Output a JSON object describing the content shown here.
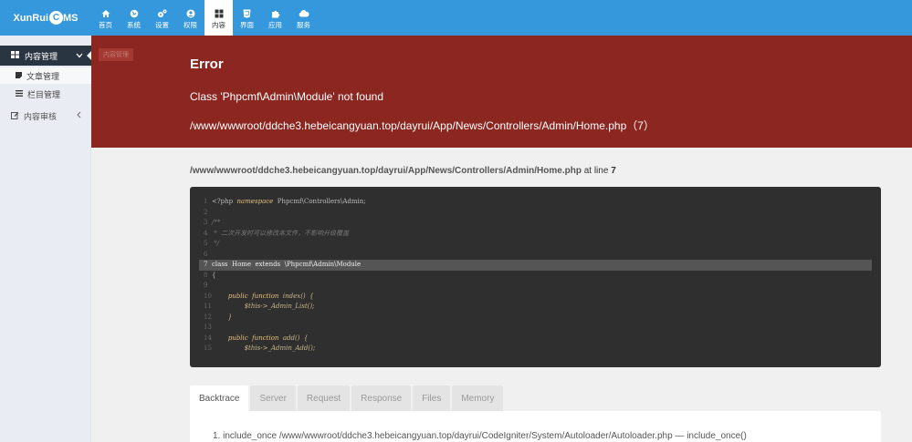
{
  "app": {
    "logo_left": "XunRui",
    "logo_c": "C",
    "logo_right": "MS"
  },
  "topnav": [
    {
      "label": "首页",
      "icon": "home-icon"
    },
    {
      "label": "系统",
      "icon": "globe-icon"
    },
    {
      "label": "设置",
      "icon": "gears-icon"
    },
    {
      "label": "权限",
      "icon": "user-icon"
    },
    {
      "label": "内容",
      "icon": "grid-icon",
      "active": true
    },
    {
      "label": "界面",
      "icon": "html5-icon"
    },
    {
      "label": "应用",
      "icon": "puzzle-icon"
    },
    {
      "label": "服务",
      "icon": "cloud-icon"
    }
  ],
  "sidebar": {
    "header": "内容管理",
    "items": [
      {
        "label": "文章管理",
        "icon": "square-icon"
      },
      {
        "label": "栏目管理",
        "icon": "list-icon"
      }
    ],
    "group": "内容审核"
  },
  "breadcrumb": "内容管理",
  "error": {
    "title": "Error",
    "message": "Class 'Phpcmf\\Admin\\Module' not found",
    "file": "/www/wwwroot/ddche3.hebeicangyuan.top/dayrui/App/News/Controllers/Admin/Home.php（7）"
  },
  "location": {
    "path": "/www/wwwroot/ddche3.hebeicangyuan.top/dayrui/App/News/Controllers/Admin/Home.php",
    "at_line": "at line",
    "line": "7"
  },
  "code_lines": [
    {
      "n": "1",
      "segs": [
        [
          "",
          "<?php  "
        ],
        [
          "kw",
          "namespace"
        ],
        [
          "",
          "  Phpcmf\\Controllers\\Admin;"
        ]
      ]
    },
    {
      "n": "2",
      "segs": []
    },
    {
      "n": "3",
      "segs": [
        [
          "cm",
          "/**"
        ]
      ]
    },
    {
      "n": "4",
      "segs": [
        [
          "cm",
          " *  二次开发时可以修改本文件，不影响升级覆盖"
        ]
      ]
    },
    {
      "n": "5",
      "segs": [
        [
          "cm",
          " */"
        ]
      ]
    },
    {
      "n": "6",
      "segs": []
    },
    {
      "n": "7",
      "hl": true,
      "segs": [
        [
          "",
          "class  Home  extends  \\Phpcmf\\Admin\\Module"
        ]
      ]
    },
    {
      "n": "8",
      "segs": [
        [
          "",
          "{"
        ]
      ]
    },
    {
      "n": "9",
      "segs": []
    },
    {
      "n": "10",
      "segs": [
        [
          "",
          "        "
        ],
        [
          "kw",
          "public  function"
        ],
        [
          "fn",
          "  index()  {"
        ]
      ]
    },
    {
      "n": "11",
      "segs": [
        [
          "fn",
          "                $this->_Admin_List();"
        ]
      ]
    },
    {
      "n": "12",
      "segs": [
        [
          "fn",
          "        }"
        ]
      ]
    },
    {
      "n": "13",
      "segs": []
    },
    {
      "n": "14",
      "segs": [
        [
          "",
          "        "
        ],
        [
          "kw",
          "public  function"
        ],
        [
          "fn",
          "  add()  {"
        ]
      ]
    },
    {
      "n": "15",
      "segs": [
        [
          "fn",
          "                $this->_Admin_Add();"
        ]
      ]
    }
  ],
  "tabs": [
    "Backtrace",
    "Server",
    "Request",
    "Response",
    "Files",
    "Memory"
  ],
  "backtrace": [
    "1. include_once /www/wwwroot/ddche3.hebeicangyuan.top/dayrui/CodeIgniter/System/Autoloader/Autoloader.php   —   include_once()"
  ],
  "colors": {
    "topbar": "#3598dc",
    "error_header": "#8b2620",
    "sidebar_header": "#2a3542",
    "code_bg": "#2f2f2f"
  }
}
